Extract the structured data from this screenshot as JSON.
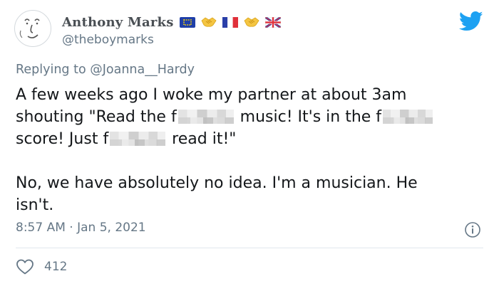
{
  "author": {
    "display_name": "Anthony Marks",
    "handle": "@theboymarks",
    "name_emojis": [
      "eu-flag-icon",
      "handshake-icon",
      "france-flag-icon",
      "handshake-icon",
      "uk-flag-icon"
    ]
  },
  "reply": {
    "prefix": "Replying to ",
    "target": "@Joanna__Hardy"
  },
  "tweet": {
    "line1": "A few weeks ago I woke my partner at about 3am",
    "line2_a": "shouting \"Read the f",
    "line2_b": " music! It's in the f",
    "line3_a": "score! Just f",
    "line3_b": " read it!\"",
    "line4": "No, we have absolutely no idea. I'm a musician. He",
    "line5": "isn't."
  },
  "meta": {
    "timestamp": "8:57 AM · Jan 5, 2021",
    "likes": "412"
  },
  "colors": {
    "brand": "#1da1f2",
    "secondary_text": "#657786",
    "primary_text": "#14171a"
  },
  "icons": {
    "platform": "twitter-bird-icon",
    "info": "info-icon",
    "like": "heart-icon"
  }
}
